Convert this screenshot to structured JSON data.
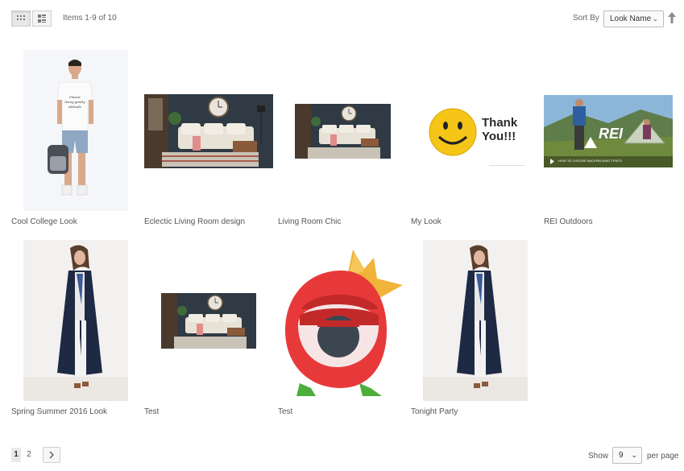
{
  "toolbar": {
    "amount_text": "Items 1-9 of 10",
    "sort_label": "Sort By",
    "sort_value": "Look Name",
    "view_modes": [
      "grid-icon",
      "list-icon"
    ]
  },
  "items": [
    {
      "name": "Cool College Look"
    },
    {
      "name": "Eclectic Living Room design"
    },
    {
      "name": "Living Room Chic"
    },
    {
      "name": "My Look"
    },
    {
      "name": "REI Outdoors"
    },
    {
      "name": "Spring Summer 2016 Look"
    },
    {
      "name": "Test"
    },
    {
      "name": "Test"
    },
    {
      "name": "Tonight Party"
    }
  ],
  "image_text": {
    "thank_you": "Thank You!!!",
    "rei_logo": "REI",
    "rei_caption": "HOW TO CHOOSE BACKPACKING TENTS",
    "tshirt": "Classic living gently attitude"
  },
  "pager": {
    "pages": [
      "1",
      "2"
    ],
    "current": "1"
  },
  "limiter": {
    "show_label": "Show",
    "value": "9",
    "per_page_label": "per page"
  }
}
